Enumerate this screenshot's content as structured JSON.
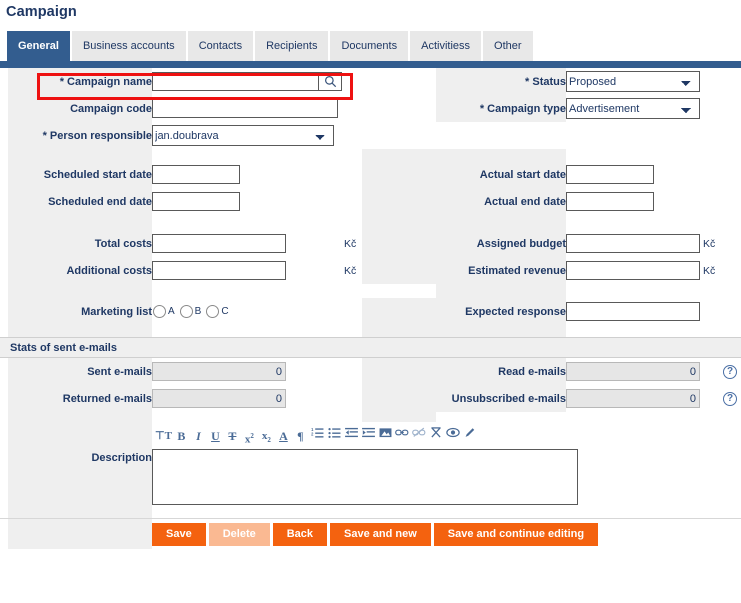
{
  "page": {
    "title": "Campaign"
  },
  "tabs": [
    {
      "label": "General",
      "active": true
    },
    {
      "label": "Business accounts",
      "active": false
    },
    {
      "label": "Contacts",
      "active": false
    },
    {
      "label": "Recipients",
      "active": false
    },
    {
      "label": "Documents",
      "active": false
    },
    {
      "label": "Activitiess",
      "active": false
    },
    {
      "label": "Other",
      "active": false
    }
  ],
  "form": {
    "campaign_name": {
      "label": "* Campaign name",
      "value": "",
      "placeholder": "",
      "search_icon": "magnifier-icon",
      "highlighted": true
    },
    "status": {
      "label": "* Status",
      "value": "Proposed",
      "options": [
        "Proposed"
      ]
    },
    "campaign_code": {
      "label": "Campaign code",
      "value": "",
      "placeholder": ""
    },
    "campaign_type": {
      "label": "* Campaign type",
      "value": "Advertisement",
      "options": [
        "Advertisement"
      ]
    },
    "person_responsible": {
      "label": "* Person responsible",
      "value": "jan.doubrava",
      "options": [
        "jan.doubrava"
      ]
    },
    "scheduled_start_date": {
      "label": "Scheduled start date",
      "value": ""
    },
    "actual_start_date": {
      "label": "Actual start date",
      "value": ""
    },
    "scheduled_end_date": {
      "label": "Scheduled end date",
      "value": ""
    },
    "actual_end_date": {
      "label": "Actual end date",
      "value": ""
    },
    "total_costs": {
      "label": "Total costs",
      "value": "",
      "suffix": "Kč"
    },
    "assigned_budget": {
      "label": "Assigned budget",
      "value": "",
      "suffix": "Kč"
    },
    "additional_costs": {
      "label": "Additional costs",
      "value": "",
      "suffix": "Kč"
    },
    "estimated_revenue": {
      "label": "Estimated revenue",
      "value": "",
      "suffix": "Kč"
    },
    "marketing_list": {
      "label": "Marketing list",
      "options": [
        "A",
        "B",
        "C"
      ],
      "selected": null
    },
    "expected_response": {
      "label": "Expected response",
      "value": ""
    }
  },
  "stats_section": {
    "title": "Stats of sent e-mails",
    "sent_emails": {
      "label": "Sent e-mails",
      "value": "0",
      "readonly": true
    },
    "read_emails": {
      "label": "Read e-mails",
      "value": "0",
      "readonly": true
    },
    "returned_emails": {
      "label": "Returned e-mails",
      "value": "0",
      "readonly": true
    },
    "unsubscribed_emails": {
      "label": "Unsubscribed e-mails",
      "value": "0",
      "readonly": true
    },
    "help_icon": "question-mark-icon"
  },
  "description": {
    "label": "Description",
    "value": "",
    "placeholder": "",
    "toolbar": [
      {
        "name": "font-size-icon",
        "glyph": "тT"
      },
      {
        "name": "bold-icon",
        "glyph": "B"
      },
      {
        "name": "italic-icon",
        "glyph": "I"
      },
      {
        "name": "underline-icon",
        "glyph": "U"
      },
      {
        "name": "strikethrough-icon",
        "glyph": "T"
      },
      {
        "name": "superscript-icon",
        "glyph": "x²"
      },
      {
        "name": "subscript-icon",
        "glyph": "x₂"
      },
      {
        "name": "text-color-icon",
        "glyph": "A"
      },
      {
        "name": "paragraph-icon",
        "glyph": "¶"
      },
      {
        "name": "ordered-list-icon",
        "glyph": ""
      },
      {
        "name": "unordered-list-icon",
        "glyph": ""
      },
      {
        "name": "outdent-icon",
        "glyph": ""
      },
      {
        "name": "indent-icon",
        "glyph": ""
      },
      {
        "name": "insert-image-icon",
        "glyph": ""
      },
      {
        "name": "insert-link-icon",
        "glyph": ""
      },
      {
        "name": "remove-link-icon",
        "glyph": ""
      },
      {
        "name": "clear-format-icon",
        "glyph": ""
      },
      {
        "name": "preview-icon",
        "glyph": ""
      },
      {
        "name": "edit-source-icon",
        "glyph": ""
      }
    ]
  },
  "footer": {
    "buttons": [
      {
        "label": "Save",
        "disabled": false
      },
      {
        "label": "Delete",
        "disabled": true
      },
      {
        "label": "Back",
        "disabled": false
      },
      {
        "label": "Save and new",
        "disabled": false
      },
      {
        "label": "Save and continue editing",
        "disabled": false
      }
    ]
  },
  "colors": {
    "brand_blue": "#335d8f",
    "text_blue": "#1f3864",
    "accent_orange": "#f4620f",
    "accent_orange_disabled": "#fab992",
    "highlight_red": "#ee1111",
    "row_grey": "#efefef"
  }
}
